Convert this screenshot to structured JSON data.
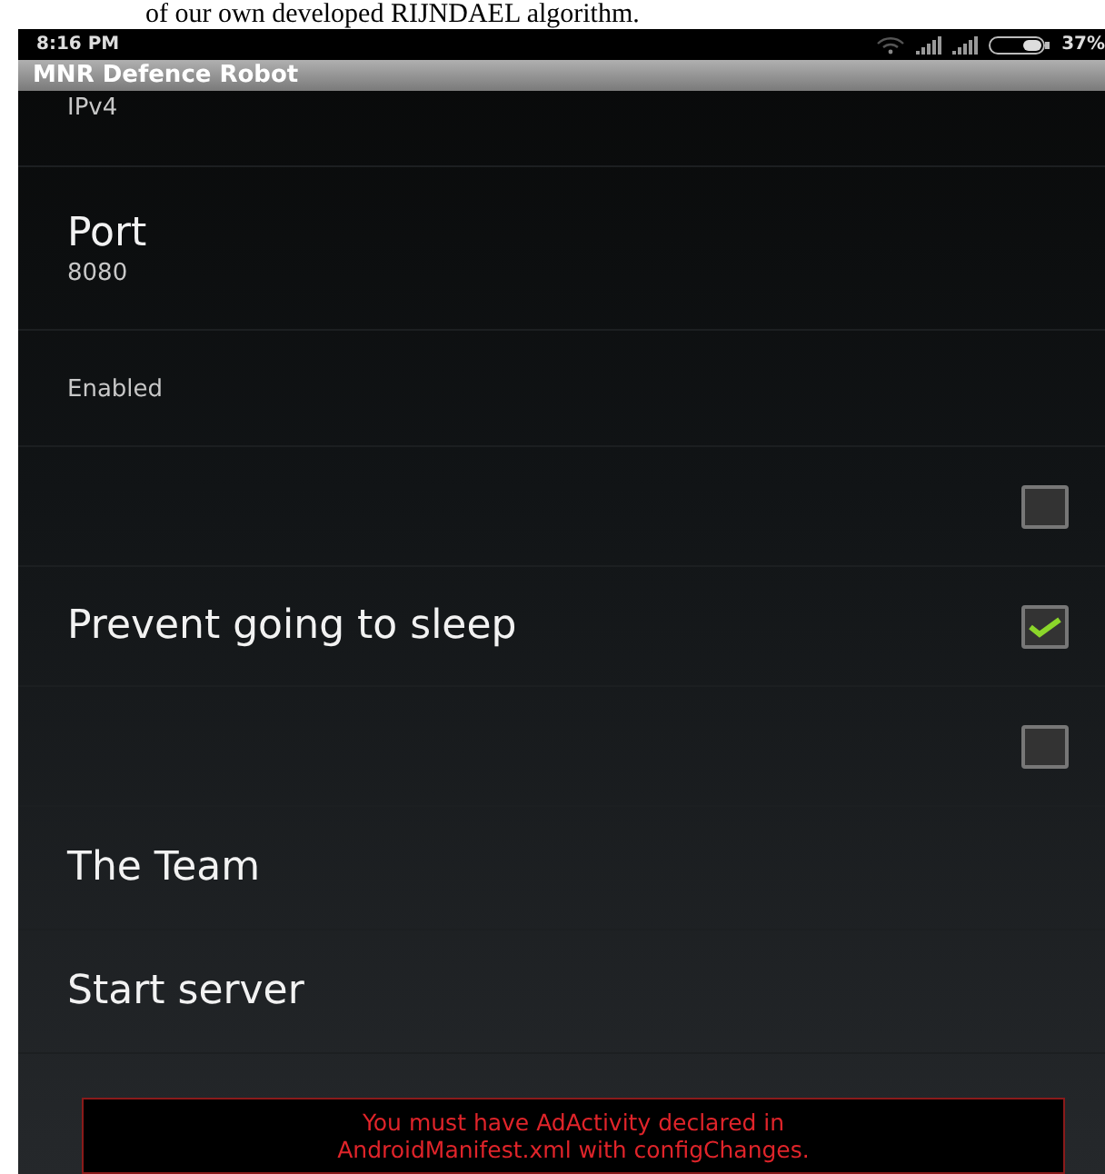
{
  "caption": "of our own developed RIJNDAEL algorithm.",
  "status_bar": {
    "time": "8:16 PM",
    "battery": "37%"
  },
  "app_bar": {
    "title": "MNR Defence Robot"
  },
  "preferences": [
    {
      "kind": "summary",
      "summary": "IPv4"
    },
    {
      "kind": "text",
      "title": "Port",
      "summary": "8080"
    },
    {
      "kind": "summary",
      "summary": "Enabled"
    },
    {
      "kind": "checkbox",
      "checked": false
    },
    {
      "kind": "checkbox",
      "title": "Prevent going to sleep",
      "checked": true
    },
    {
      "kind": "checkbox",
      "checked": false
    },
    {
      "kind": "text",
      "title": "The Team"
    },
    {
      "kind": "text",
      "title": "Start server"
    }
  ],
  "ad_banner": {
    "message": "You must have AdActivity declared in AndroidManifest.xml with configChanges."
  }
}
